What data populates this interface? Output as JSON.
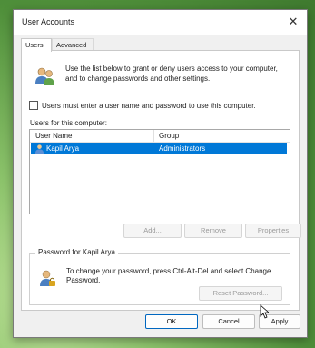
{
  "window": {
    "title": "User Accounts"
  },
  "tabs": [
    {
      "label": "Users"
    },
    {
      "label": "Advanced"
    }
  ],
  "intro_text": "Use the list below to grant or deny users access to your computer, and to change passwords and other settings.",
  "checkbox": {
    "label": "Users must enter a user name and password to use this computer.",
    "checked": false
  },
  "users_section": {
    "caption": "Users for this computer:",
    "columns": [
      "User Name",
      "Group"
    ],
    "rows": [
      {
        "user": "Kapil Arya",
        "group": "Administrators",
        "selected": true
      }
    ]
  },
  "list_buttons": {
    "add": "Add...",
    "remove": "Remove",
    "properties": "Properties"
  },
  "password_group": {
    "legend": "Password for Kapil Arya",
    "text": "To change your password, press Ctrl-Alt-Del and select Change Password.",
    "reset_button": "Reset Password..."
  },
  "dialog_buttons": {
    "ok": "OK",
    "cancel": "Cancel",
    "apply": "Apply"
  },
  "colors": {
    "selection": "#0078d7",
    "default_button_border": "#0067c0"
  }
}
